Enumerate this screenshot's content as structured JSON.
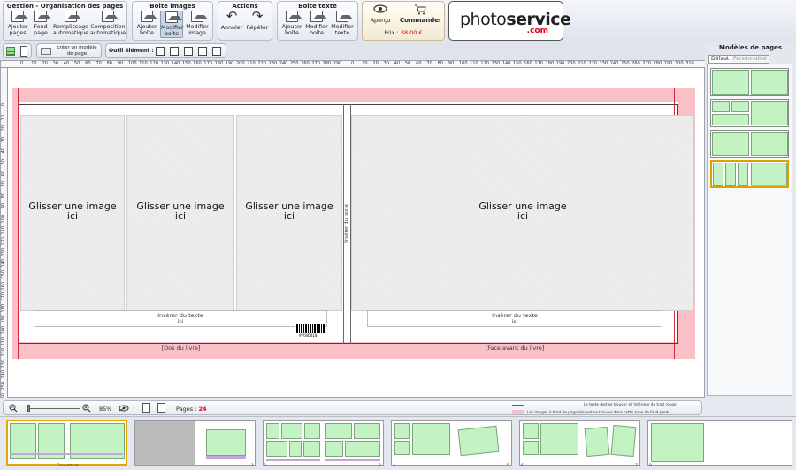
{
  "ribbon": {
    "groups": {
      "gestion": {
        "title": "Gestion - Organisation des pages",
        "buttons": [
          {
            "label1": "Ajouter",
            "label2": "pages"
          },
          {
            "label1": "Fond",
            "label2": "page"
          },
          {
            "label1": "Remplissage",
            "label2": "automatique"
          },
          {
            "label1": "Composition",
            "label2": "automatique"
          }
        ]
      },
      "boite_images": {
        "title": "Boîte images",
        "buttons": [
          {
            "label1": "Ajouter",
            "label2": "boîte"
          },
          {
            "label1": "Modifier",
            "label2": "boîte"
          },
          {
            "label1": "Modifier",
            "label2": "image"
          }
        ]
      },
      "actions": {
        "title": "Actions",
        "undo": "Annuler",
        "redo": "Répéter"
      },
      "boite_texte": {
        "title": "Boîte texte",
        "buttons": [
          {
            "label1": "Ajouter",
            "label2": "boîte"
          },
          {
            "label1": "Modifier",
            "label2": "boîte"
          },
          {
            "label1": "Modifier",
            "label2": "texte"
          }
        ]
      }
    },
    "order": {
      "preview_label": "Aperçu",
      "order_label": "Commander",
      "price_label": "Prix :",
      "price_value": "38.00 €"
    },
    "logo": {
      "part1": "photo",
      "part2": "service",
      "part3": ".com"
    }
  },
  "toolbar2": {
    "create_model_line1": "créer un modèle",
    "create_model_line2": "de page",
    "tool_label": "Outil élément :"
  },
  "ruler": {
    "h_left": [
      "0",
      "10",
      "20",
      "30",
      "40",
      "50",
      "60",
      "70",
      "80",
      "90",
      "100",
      "110",
      "120",
      "130",
      "140",
      "150",
      "160",
      "170",
      "180",
      "190",
      "200",
      "210",
      "220",
      "230",
      "240",
      "250",
      "260",
      "270",
      "280",
      "290"
    ],
    "h_right": [
      "0",
      "10",
      "20",
      "30",
      "40",
      "50",
      "60",
      "70",
      "80",
      "90",
      "100",
      "110",
      "120",
      "130",
      "140",
      "150",
      "160",
      "170",
      "180",
      "190",
      "200",
      "210",
      "220",
      "230",
      "240",
      "250",
      "260",
      "270",
      "280",
      "290",
      "300",
      "310"
    ],
    "v": [
      "0",
      "10",
      "20",
      "30",
      "40",
      "50",
      "60",
      "70",
      "80",
      "90",
      "100",
      "110",
      "120",
      "130",
      "140",
      "150",
      "160",
      "170",
      "180",
      "190",
      "200",
      "210",
      "220",
      "230",
      "240",
      "250",
      "260",
      "270"
    ]
  },
  "canvas": {
    "photo_placeholder_line1": "Glisser une image",
    "photo_placeholder_line2": "ici",
    "text_placeholder_line1": "Insérer du texte",
    "text_placeholder_line2": "ici",
    "spine_text": "Insérer du texte",
    "back_label": "[Dos du livre]",
    "front_label": "[Face avant du livre]",
    "barcode_number": "97040018"
  },
  "right_panel": {
    "title": "Modèles de pages",
    "tabs": [
      "Défaut",
      "Personnalisé"
    ]
  },
  "statusbar": {
    "zoom": "85%",
    "pages_label": "Pages :",
    "pages_count": "24",
    "legend_red": "Le texte doit se trouver à l'intérieur du trait rouge.",
    "legend_pink": "Les images à bord de page doivent se trouver dans cette zone de fond perdu."
  },
  "filmstrip": {
    "cover_label": "Couverture",
    "page_numbers": [
      "1",
      "2",
      "3",
      "4",
      "5",
      "6",
      "7",
      "8"
    ]
  },
  "colors": {
    "bleed": "#f9c1c7",
    "safety_line": "#d42a3a",
    "model_cell": "#c3f3c3",
    "selection": "#e6a700",
    "price": "#e2001a"
  }
}
